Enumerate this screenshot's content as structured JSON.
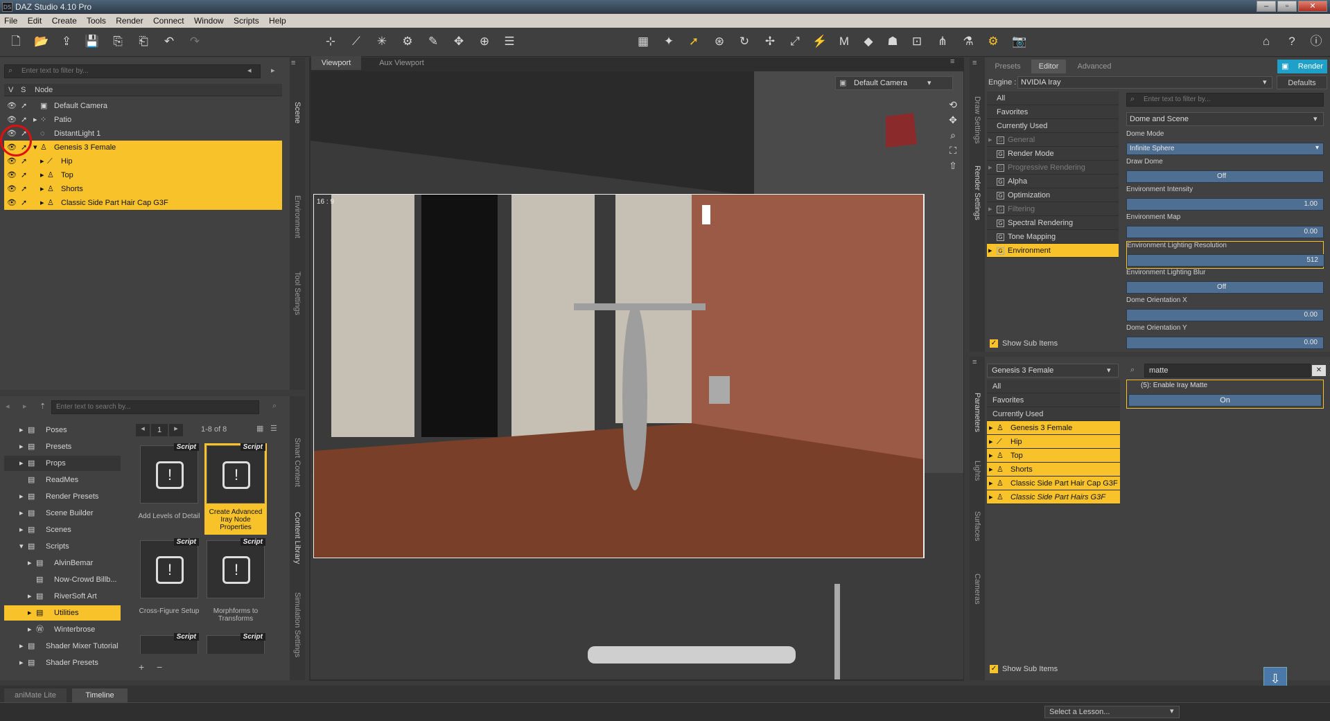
{
  "app": {
    "title": "DAZ Studio 4.10 Pro",
    "logo": "DS"
  },
  "menu": [
    "File",
    "Edit",
    "Create",
    "Tools",
    "Render",
    "Connect",
    "Window",
    "Scripts",
    "Help"
  ],
  "scene": {
    "filter_placeholder": "Enter text to filter by...",
    "col_v": "V",
    "col_s": "S",
    "col_node": "Node",
    "tab": "Scene",
    "rows": [
      "Default Camera",
      "Patio",
      "DistantLight 1",
      "Genesis 3 Female",
      "Hip",
      "Top",
      "Shorts",
      "Classic Side Part Hair Cap G3F"
    ]
  },
  "left_tabs": [
    "Scene",
    "Environment",
    "Tool Settings"
  ],
  "library": {
    "search_placeholder": "Enter text to search by...",
    "items": [
      "Poses",
      "Presets",
      "Props",
      "ReadMes",
      "Render Presets",
      "Scene Builder",
      "Scenes",
      "Scripts",
      "AlvinBemar",
      "Now-Crowd Billb...",
      "RiverSoft Art",
      "Utilities",
      "Winterbrose",
      "Shader Mixer Tutorial",
      "Shader Presets"
    ],
    "page": "1",
    "page_info": "1-8 of 8",
    "tiles": [
      {
        "tag": "Script",
        "label": "Add Levels of Detail"
      },
      {
        "tag": "Script",
        "label": "Create Advanced Iray Node Properties"
      },
      {
        "tag": "Script",
        "label": "Cross-Figure Setup"
      },
      {
        "tag": "Script",
        "label": "Morphforms to Transforms"
      },
      {
        "tag": "Script",
        "label": ""
      },
      {
        "tag": "Script",
        "label": ""
      }
    ],
    "side_tabs": [
      "Smart Content",
      "Content Library",
      "Simulation Settings"
    ]
  },
  "viewport": {
    "tab1": "Viewport",
    "tab2": "Aux Viewport",
    "camera": "Default Camera",
    "aspect": "16 : 9"
  },
  "render_panel": {
    "tabs": [
      "Presets",
      "Editor",
      "Advanced"
    ],
    "render_btn": "Render",
    "engine_label": "Engine :",
    "engine": "NVIDIA Iray",
    "defaults": "Defaults",
    "filter_placeholder": "Enter text to filter by...",
    "dropdown": "Dome and Scene",
    "categories": [
      "All",
      "Favorites",
      "Currently Used",
      "General",
      "Render Mode",
      "Progressive Rendering",
      "Alpha",
      "Optimization",
      "Filtering",
      "Spectral Rendering",
      "Tone Mapping",
      "Environment"
    ],
    "show_sub": "Show Sub Items",
    "side_tabs": [
      "Draw Settings",
      "Render Settings"
    ],
    "props": [
      {
        "name": "Dome Mode",
        "value": "Infinite Sphere"
      },
      {
        "name": "Draw Dome",
        "value": "Off"
      },
      {
        "name": "Environment Intensity",
        "value": "1.00"
      },
      {
        "name": "Environment Map",
        "value": "0.00"
      },
      {
        "name": "Environment Lighting Resolution",
        "value": "512"
      },
      {
        "name": "Environment Lighting Blur",
        "value": "Off"
      },
      {
        "name": "Dome Orientation X",
        "value": "0.00"
      },
      {
        "name": "Dome Orientation Y",
        "value": "0.00"
      }
    ]
  },
  "params_panel": {
    "figure": "Genesis 3 Female",
    "filter_value": "matte",
    "categories": [
      "All",
      "Favorites",
      "Currently Used",
      "Genesis 3 Female",
      "Hip",
      "Top",
      "Shorts",
      "Classic Side Part Hair Cap G3F",
      "Classic Side Part Hairs G3F"
    ],
    "result_header": "(5): Enable Iray Matte",
    "result_value": "On",
    "show_sub": "Show Sub Items",
    "side_tabs": [
      "Parameters",
      "Lights",
      "Surfaces",
      "Cameras"
    ]
  },
  "bottom": {
    "tab1": "aniMate Lite",
    "tab2": "Timeline",
    "lesson": "Select a Lesson..."
  }
}
